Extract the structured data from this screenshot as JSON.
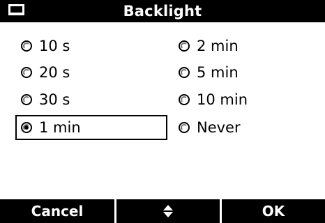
{
  "title": {
    "text": "Backlight",
    "icon": "screen-icon"
  },
  "options": [
    {
      "label": "10 s",
      "checked": false
    },
    {
      "label": "20 s",
      "checked": false
    },
    {
      "label": "30 s",
      "checked": false
    },
    {
      "label": "1 min",
      "checked": true
    },
    {
      "label": "2 min",
      "checked": false
    },
    {
      "label": "5 min",
      "checked": false
    },
    {
      "label": "10 min",
      "checked": false
    },
    {
      "label": "Never",
      "checked": false
    }
  ],
  "softkeys": {
    "left": "Cancel",
    "middle_icon": "up-down-arrows-icon",
    "right": "OK"
  },
  "colors": {
    "background": "#ffffff",
    "bar": "#000000",
    "bar_text": "#ffffff",
    "text": "#000000"
  }
}
